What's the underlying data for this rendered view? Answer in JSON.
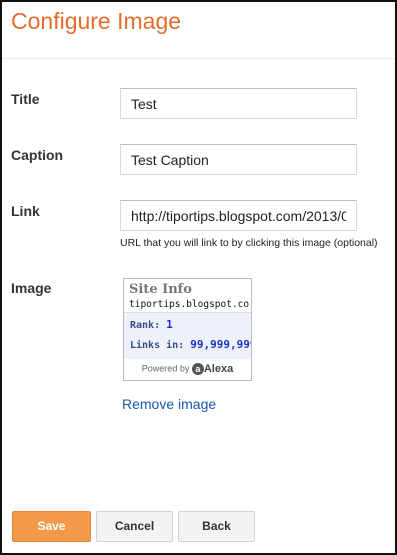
{
  "dialog": {
    "title": "Configure Image"
  },
  "form": {
    "title_label": "Title",
    "title_value": "Test",
    "caption_label": "Caption",
    "caption_value": "Test Caption",
    "link_label": "Link",
    "link_value": "http://tiportips.blogspot.com/2013/0",
    "link_hint": "URL that you will link to by clicking this image (optional)",
    "image_label": "Image"
  },
  "image_preview": {
    "widget_title": "Site Info",
    "site": "tiportips.blogspot.co...",
    "rank_label": "Rank:",
    "rank_value": "1",
    "links_label": "Links in:",
    "links_value": "99,999,999",
    "powered_by": "Powered by",
    "alexa_logo_letter": "a",
    "alexa_logo_word": "Alexa"
  },
  "actions": {
    "remove_image": "Remove image",
    "save": "Save",
    "cancel": "Cancel",
    "back": "Back"
  },
  "colors": {
    "title": "#e46d2e",
    "save_button": "#f39a4a",
    "link": "#1a56b0"
  }
}
